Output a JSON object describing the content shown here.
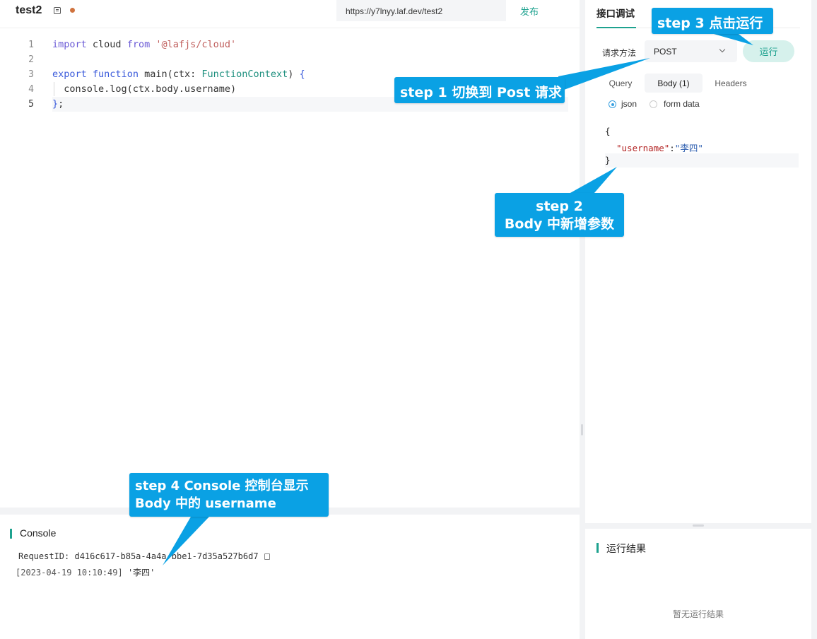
{
  "editor_header": {
    "function_name": "test2",
    "url": "https://y7lnyy.laf.dev/test2",
    "publish_label": "发布"
  },
  "editor": {
    "lines": [
      {
        "num": "1",
        "code_html": "<span class=\"kw2\">import</span> cloud <span class=\"kw2\">from</span> <span class=\"str\">'@lafjs/cloud'</span>"
      },
      {
        "num": "2",
        "code_html": ""
      },
      {
        "num": "3",
        "code_html": "<span class=\"kw\">export</span> <span class=\"kw\">function</span> main(ctx: <span class=\"ty\">FunctionContext</span>) <span class=\"kw\">{</span>"
      },
      {
        "num": "4",
        "code_html": "  console.log(ctx.body.username)"
      },
      {
        "num": "5",
        "code_html": "<span class=\"kw\">}</span>;"
      }
    ]
  },
  "console": {
    "title": "Console",
    "request_id": "RequestID: d416c617-b85a-4a4a-bbe1-7d35a527b6d7",
    "log_timestamp": "[2023-04-19 10:10:49]",
    "log_value": " '李四'"
  },
  "debug_panel": {
    "tab_label": "接口调试",
    "method_label": "请求方法",
    "method_value": "POST",
    "run_label": "运行",
    "subtabs": [
      "Query",
      "Body (1)",
      "Headers"
    ],
    "radio_json": "json",
    "radio_form": "form data",
    "body_open": "{",
    "body_key": "\"username\"",
    "body_colon": ":",
    "body_value": "\"李四\"",
    "body_close": "}"
  },
  "result_panel": {
    "title": "运行结果",
    "empty_text": "暂无运行结果"
  },
  "callouts": {
    "step1": "step 1 切换到 Post 请求",
    "step2_line1": "step 2",
    "step2_line2": "Body 中新增参数",
    "step3": "step 3 点击运行",
    "step4_line1": "step 4 Console 控制台显示",
    "step4_line2": "Body 中的 username"
  },
  "colors": {
    "accent": "#1ea28f",
    "callout": "#0aa1e4"
  }
}
